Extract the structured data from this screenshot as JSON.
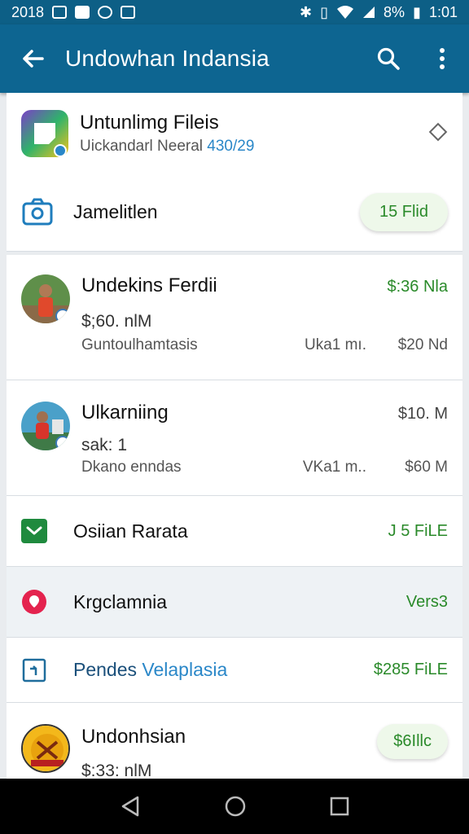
{
  "status_bar": {
    "left_text": "2018",
    "battery": "8%",
    "time": "1:01"
  },
  "app_bar": {
    "title": "Undowhan Indansia"
  },
  "header_card": {
    "app_title": "Untunlimg Fileis",
    "app_subtitle_prefix": "Uickandarl Neeral",
    "app_subtitle_highlight": "430/29",
    "camera_label": "Jamelitlen",
    "camera_pill": "15 Flid"
  },
  "items": [
    {
      "title": "Undekins Ferdii",
      "price": "$:36 Nla",
      "sub": "$;60. nlM",
      "desc": "Guntoulhamtasis",
      "mid": "Uka1 mı.",
      "right": "$20 Nd"
    },
    {
      "title": "Ulkarniing",
      "price": "$10. M",
      "sub": "sak: 1",
      "desc": "Dkano enndas",
      "mid": "VKa1 m..",
      "right": "$60 M"
    }
  ],
  "simple_items": [
    {
      "label": "Osiian Rarata",
      "value": "J 5 FiLE"
    },
    {
      "label": "Krgclamnia",
      "value": "Vers3"
    },
    {
      "label_a": "Pendes",
      "label_b": "Velaplasia",
      "value": "$285 FiLE"
    }
  ],
  "last_item": {
    "title": "Undonhsian",
    "sub": "$:33: nlM",
    "pill": "$6Illc"
  },
  "colors": {
    "app_bar": "#0d6591",
    "green": "#2a8a2a",
    "accent_blue": "#2a87c8"
  }
}
